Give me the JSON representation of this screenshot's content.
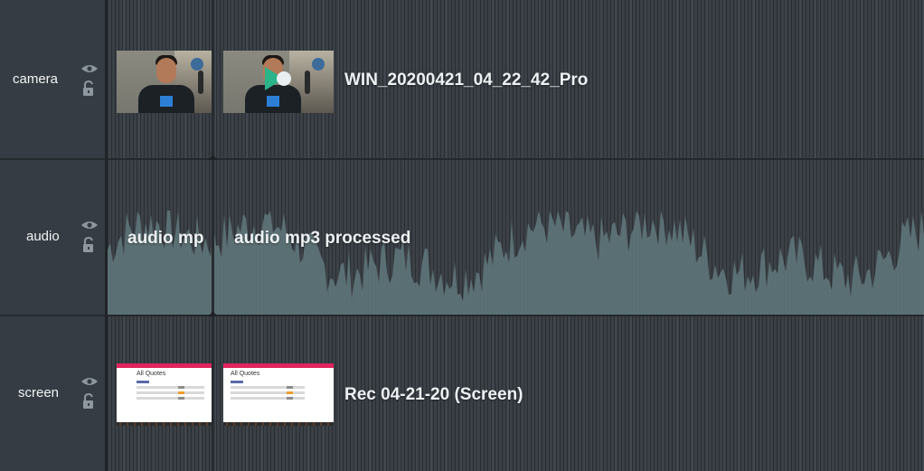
{
  "tracks": [
    {
      "id": "camera",
      "label": "camera",
      "clip_short": "",
      "clip_title": "WIN_20200421_04_22_42_Pro"
    },
    {
      "id": "audio",
      "label": "audio",
      "clip_short": "audio mp",
      "clip_title": "audio mp3 processed"
    },
    {
      "id": "screen",
      "label": "screen",
      "clip_short": "",
      "clip_title": "Rec 04-21-20 (Screen)"
    }
  ],
  "screen_thumb": {
    "title": "All Quotes"
  },
  "colors": {
    "header_bg": "#353c43",
    "lane_bg": "#3a4046",
    "waveform": "#5f7679",
    "play_accent": "#2bb38a"
  },
  "icons": {
    "visibility": "eye-icon",
    "lock": "lock-icon",
    "play": "play-icon"
  }
}
